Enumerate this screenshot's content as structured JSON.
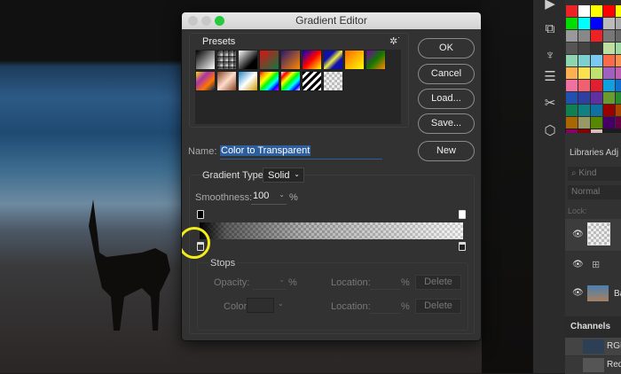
{
  "dialog": {
    "title": "Gradient Editor",
    "presets_label": "Presets",
    "buttons": {
      "ok": "OK",
      "cancel": "Cancel",
      "load": "Load...",
      "save": "Save...",
      "new": "New"
    },
    "name_label": "Name:",
    "name_value": "Color to Transparent",
    "gradient_type_label": "Gradient Type:",
    "gradient_type_value": "Solid",
    "smoothness_label": "Smoothness:",
    "smoothness_value": "100",
    "percent": "%",
    "stops": {
      "title": "Stops",
      "opacity_label": "Opacity:",
      "color_label": "Color:",
      "location_label": "Location:",
      "delete_label": "Delete"
    }
  },
  "panels": {
    "libraries_tab": "Libraries",
    "adjustments_tab": "Adj",
    "kind_placeholder": "Kind",
    "blend_mode": "Normal",
    "lock_label": "Lock:",
    "layer_bg_label": "Ba",
    "channels_tab": "Channels",
    "channels": [
      "RGB",
      "Red"
    ]
  },
  "colors": {
    "accent_highlight": "#2d5f9e",
    "highlight_circle": "#f2ec1a"
  }
}
